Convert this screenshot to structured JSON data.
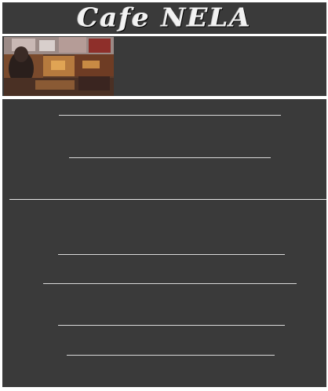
{
  "header": {
    "logo_text": "Cafe NELA",
    "logo_color": "#f2f2f2"
  },
  "hero": {
    "image_semantic": "cafe-interior-photo"
  },
  "colors": {
    "panel_bg": "#3a3a3a",
    "rule": "#d9d9d9",
    "page_bg": "#ffffff"
  }
}
